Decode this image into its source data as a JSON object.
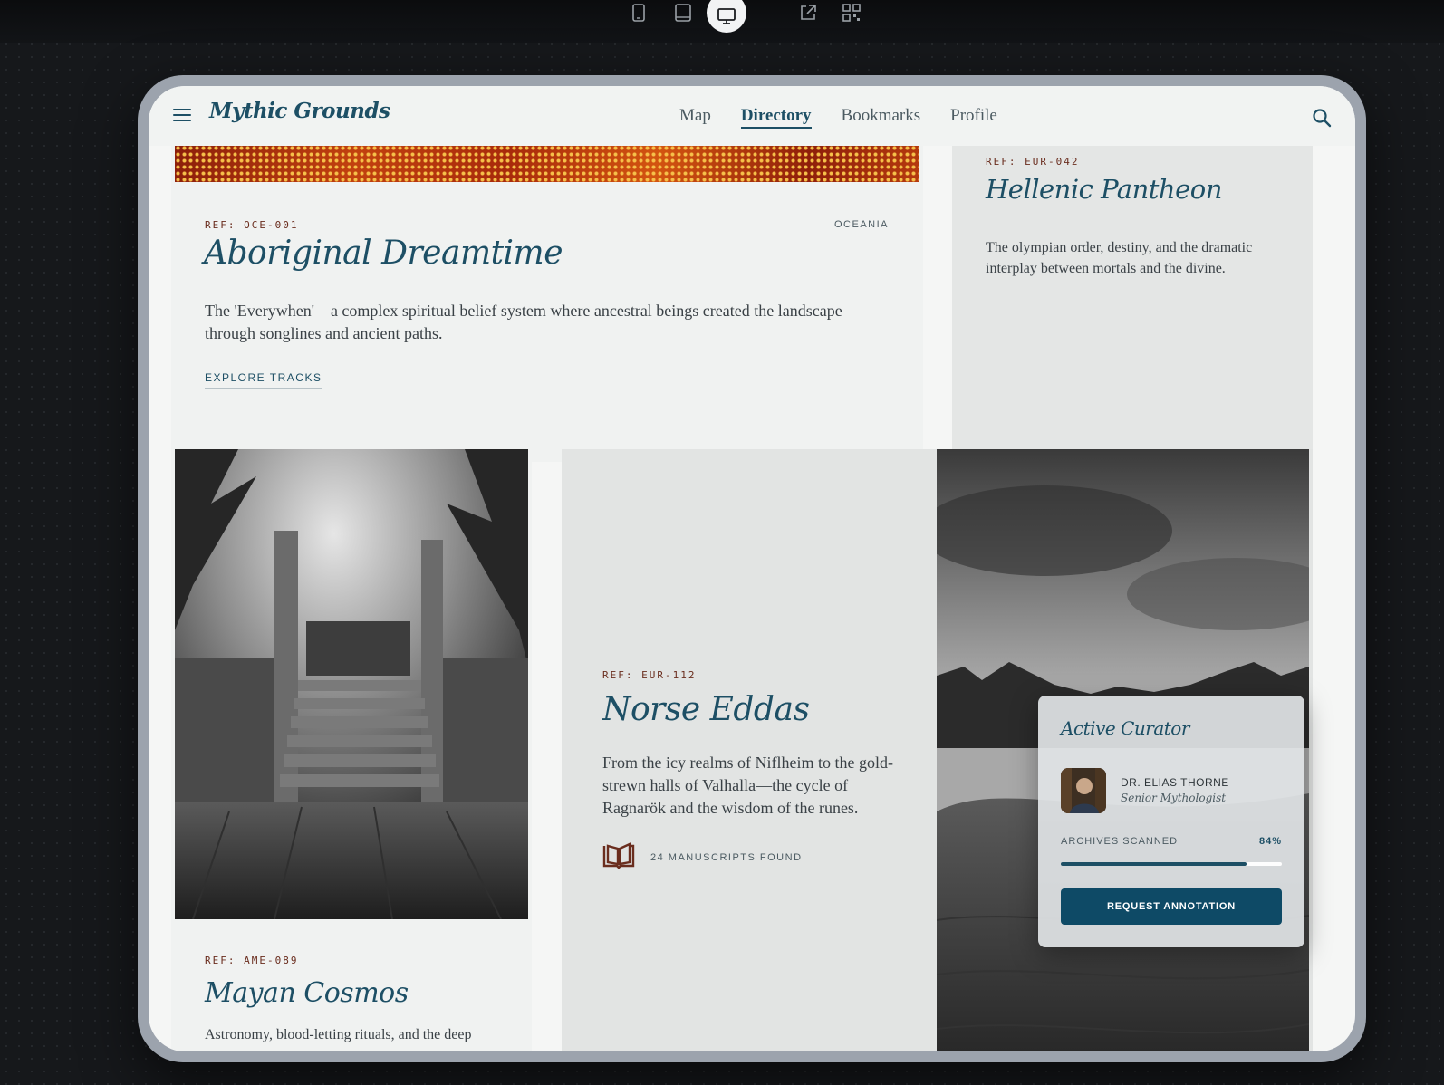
{
  "app": {
    "brand": "Mythic Grounds"
  },
  "nav": {
    "links": [
      "Map",
      "Directory",
      "Bookmarks",
      "Profile"
    ],
    "active": "Directory"
  },
  "toolbar": {
    "icons": [
      "mobile-icon",
      "tablet-icon",
      "desktop-icon",
      "external-link-icon",
      "qr-code-icon"
    ],
    "active": "desktop-icon"
  },
  "cards": {
    "aboriginal": {
      "ref": "REF: OCE-001",
      "region": "OCEANIA",
      "title": "Aboriginal Dreamtime",
      "description": "The 'Everywhen'—a complex spiritual belief system where ancestral beings created the landscape through songlines and ancient paths.",
      "cta": "EXPLORE TRACKS"
    },
    "hellenic": {
      "ref": "REF: EUR-042",
      "title": "Hellenic Pantheon",
      "description": "The olympian order, destiny, and the dramatic interplay between mortals and the divine."
    },
    "mayan": {
      "ref": "REF: AME-089",
      "title": "Mayan Cosmos",
      "description": "Astronomy, blood-letting rituals, and the deep"
    },
    "norse": {
      "ref": "REF: EUR-112",
      "title": "Norse Eddas",
      "description": "From the icy realms of Niflheim to the gold-strewn halls of Valhalla—the cycle of Ragnarök and the wisdom of the runes.",
      "manuscripts": "24 MANUSCRIPTS FOUND"
    }
  },
  "curator": {
    "title": "Active Curator",
    "name": "DR. ELIAS THORNE",
    "role": "Senior Mythologist",
    "progress_label": "ARCHIVES SCANNED",
    "progress_text": "84%",
    "progress": 0.84,
    "button": "REQUEST ANNOTATION"
  },
  "colors": {
    "accent": "#1d4f65",
    "ref_text": "#6a2d1e",
    "button": "#0e4a66"
  }
}
